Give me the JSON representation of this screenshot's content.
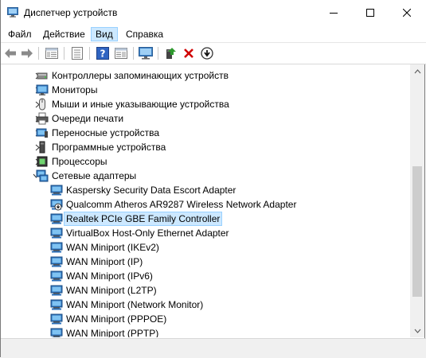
{
  "window": {
    "title": "Диспетчер устройств"
  },
  "menu": {
    "items": [
      {
        "label": "Файл"
      },
      {
        "label": "Действие"
      },
      {
        "label": "Вид"
      },
      {
        "label": "Справка"
      }
    ]
  },
  "toolbar": {
    "icons": [
      "back-icon",
      "forward-icon",
      "properties-pane-icon",
      "list-view-icon",
      "help-icon",
      "details-pane-icon",
      "scan-hardware-icon",
      "update-driver-icon",
      "uninstall-icon",
      "disable-icon"
    ]
  },
  "tree": {
    "categories": [
      {
        "label": "Контроллеры запоминающих устройств",
        "icon": "storage-controller-icon"
      },
      {
        "label": "Мониторы",
        "icon": "monitor-icon"
      },
      {
        "label": "Мыши и иные указывающие устройства",
        "icon": "mouse-icon"
      },
      {
        "label": "Очереди печати",
        "icon": "printer-icon"
      },
      {
        "label": "Переносные устройства",
        "icon": "portable-device-icon"
      },
      {
        "label": "Программные устройства",
        "icon": "software-device-icon"
      },
      {
        "label": "Процессоры",
        "icon": "processor-icon"
      },
      {
        "label": "Сетевые адаптеры",
        "icon": "network-adapter-icon",
        "expanded": true
      }
    ],
    "adapters": [
      {
        "label": "Kaspersky Security Data Escort Adapter"
      },
      {
        "label": "Qualcomm Atheros AR9287 Wireless Network Adapter",
        "disabled": true
      },
      {
        "label": "Realtek PCIe GBE Family Controller",
        "selected": true
      },
      {
        "label": "VirtualBox Host-Only Ethernet Adapter"
      },
      {
        "label": "WAN Miniport (IKEv2)"
      },
      {
        "label": "WAN Miniport (IP)"
      },
      {
        "label": "WAN Miniport (IPv6)"
      },
      {
        "label": "WAN Miniport (L2TP)"
      },
      {
        "label": "WAN Miniport (Network Monitor)"
      },
      {
        "label": "WAN Miniport (PPPOE)"
      },
      {
        "label": "WAN Miniport (PPTP)"
      }
    ]
  },
  "colors": {
    "selection": "#cce8ff",
    "selection_border": "#99d1ff",
    "accent_blue": "#1e6fc9",
    "uninstall_red": "#d00000",
    "update_green": "#2e9a2e"
  }
}
